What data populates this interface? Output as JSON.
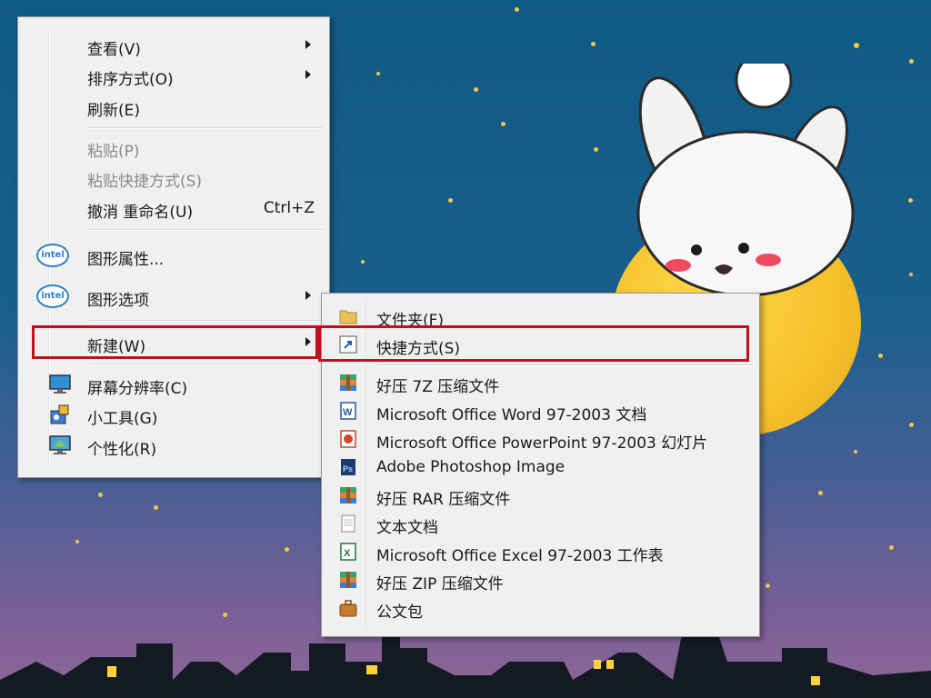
{
  "context_menu": {
    "items": [
      {
        "label": "查看(V)",
        "has_submenu": true
      },
      {
        "label": "排序方式(O)",
        "has_submenu": true
      },
      {
        "label": "刷新(E)"
      },
      {
        "label": "粘贴(P)",
        "disabled": true
      },
      {
        "label": "粘贴快捷方式(S)",
        "disabled": true
      },
      {
        "label": "撤消 重命名(U)",
        "shortcut": "Ctrl+Z"
      },
      {
        "label": "图形属性...",
        "icon": "intel-icon"
      },
      {
        "label": "图形选项",
        "icon": "intel-icon",
        "has_submenu": true
      },
      {
        "label": "新建(W)",
        "has_submenu": true,
        "highlighted": true
      },
      {
        "label": "屏幕分辨率(C)",
        "icon": "monitor-icon"
      },
      {
        "label": "小工具(G)",
        "icon": "gadgets-icon"
      },
      {
        "label": "个性化(R)",
        "icon": "personalize-icon"
      }
    ]
  },
  "new_submenu": {
    "items": [
      {
        "label": "文件夹(F)",
        "icon": "folder-icon"
      },
      {
        "label": "快捷方式(S)",
        "icon": "shortcut-icon",
        "highlighted": true
      },
      {
        "label": "好压 7Z 压缩文件",
        "icon": "archive-icon"
      },
      {
        "label": "Microsoft Office Word 97-2003 文档",
        "icon": "word-icon"
      },
      {
        "label": "Microsoft Office PowerPoint 97-2003 幻灯片",
        "icon": "powerpoint-icon"
      },
      {
        "label": "Adobe Photoshop Image",
        "icon": "photoshop-icon"
      },
      {
        "label": "好压 RAR 压缩文件",
        "icon": "archive-icon"
      },
      {
        "label": "文本文档",
        "icon": "text-doc-icon"
      },
      {
        "label": "Microsoft Office Excel 97-2003 工作表",
        "icon": "excel-icon"
      },
      {
        "label": "好压 ZIP 压缩文件",
        "icon": "archive-icon"
      },
      {
        "label": "公文包",
        "icon": "briefcase-icon"
      }
    ]
  },
  "intel_text": "intel",
  "colors": {
    "highlight_border": "#c0101c",
    "menu_bg": "#f0f0f0",
    "sky_top": "#0f5a85",
    "moon": "#f6c12c"
  }
}
